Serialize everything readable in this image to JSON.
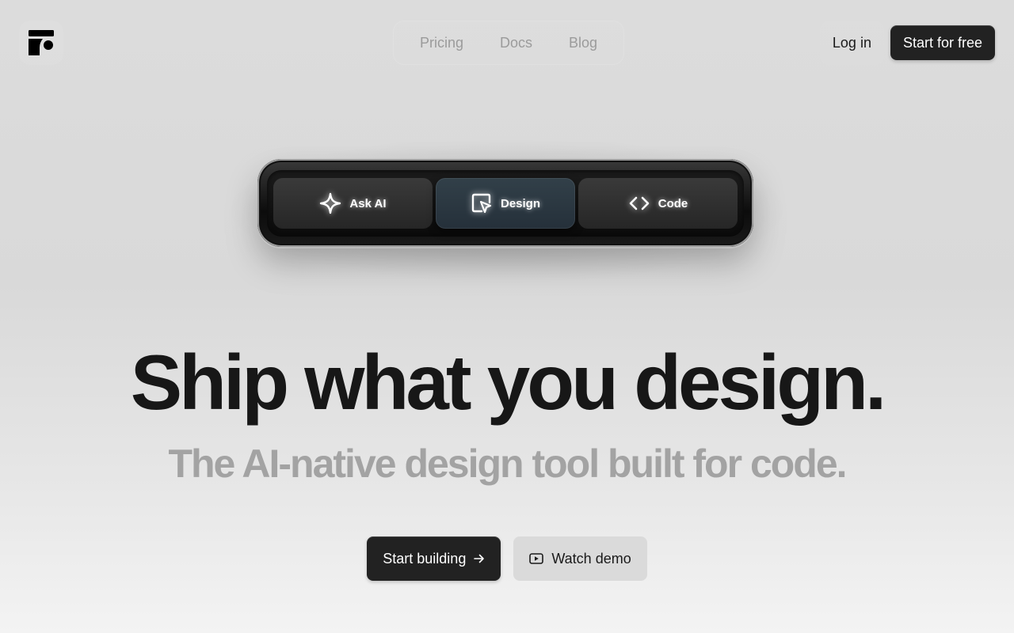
{
  "header": {
    "logo": "brand-logo",
    "nav": [
      {
        "label": "Pricing"
      },
      {
        "label": "Docs"
      },
      {
        "label": "Blog"
      }
    ],
    "login_label": "Log in",
    "start_free_label": "Start for free"
  },
  "toolbar": {
    "items": [
      {
        "label": "Ask AI",
        "icon": "sparkle-icon"
      },
      {
        "label": "Design",
        "icon": "cursor-frame-icon",
        "active": true
      },
      {
        "label": "Code",
        "icon": "code-brackets-icon"
      }
    ]
  },
  "hero": {
    "headline": "Ship what you design.",
    "subhead": "The AI-native design tool built for code.",
    "primary_cta": "Start building",
    "secondary_cta": "Watch demo"
  },
  "colors": {
    "dark": "#222222",
    "muted_text": "#a3a3a3",
    "nav_text": "#9b9b9b"
  }
}
